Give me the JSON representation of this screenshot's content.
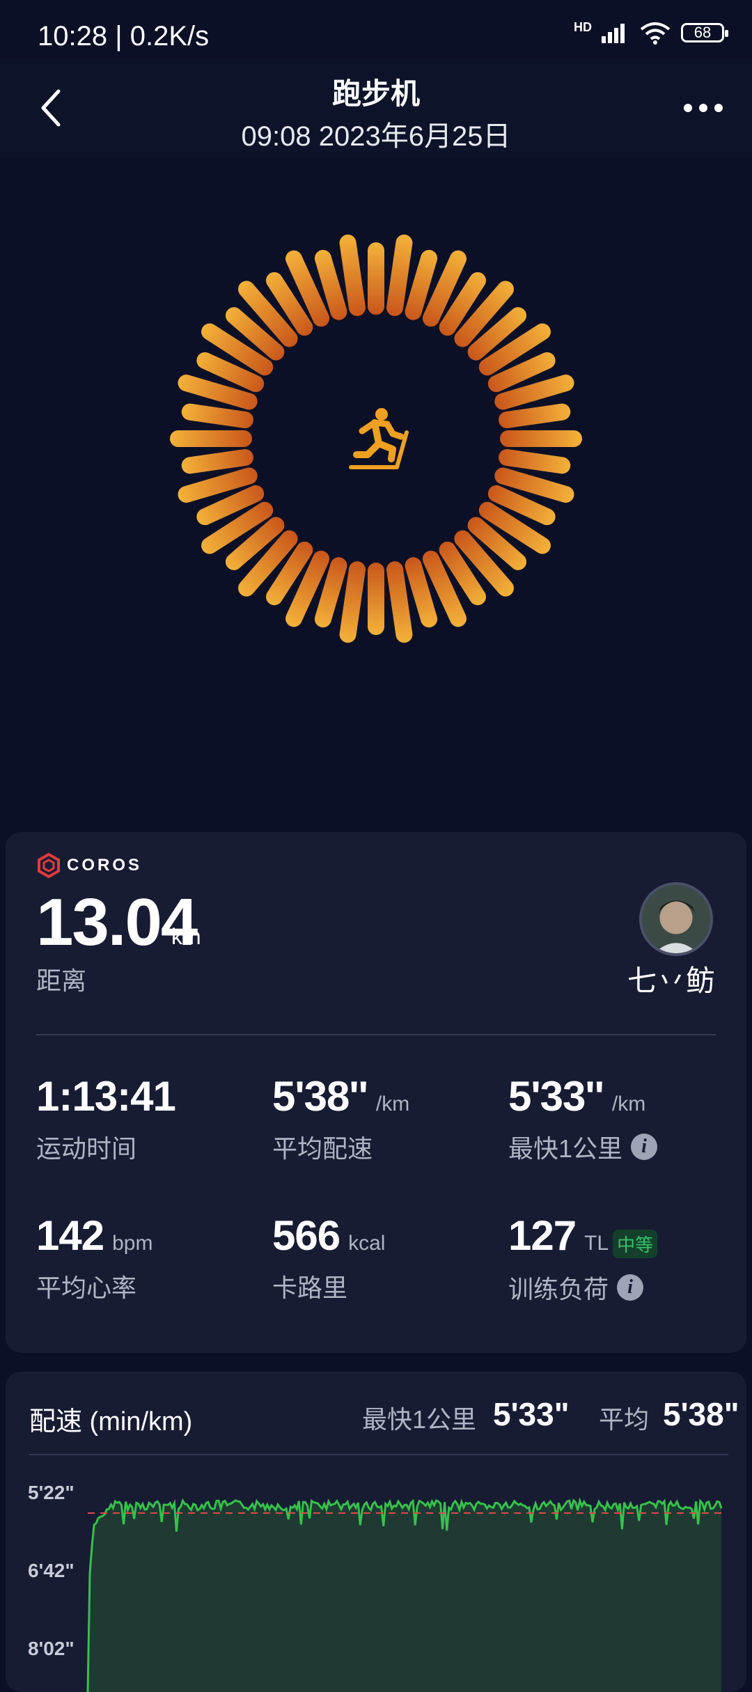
{
  "status_bar": {
    "time_speed": "10:28 | 0.2K/s",
    "network": "HD",
    "battery": "68"
  },
  "header": {
    "title": "跑步机",
    "datetime": "09:08 2023年6月25日"
  },
  "summary": {
    "brand": "COROS",
    "distance": {
      "value": "13.04",
      "unit": "km",
      "label": "距离"
    },
    "user": {
      "name": "七丷鲂"
    },
    "stats": [
      {
        "value": "1:13:41",
        "unit": "",
        "label": "运动时间"
      },
      {
        "value": "5'38''",
        "unit": "/km",
        "label": "平均配速"
      },
      {
        "value": "5'33''",
        "unit": "/km",
        "label": "最快1公里"
      },
      {
        "value": "142",
        "unit": "bpm",
        "label": "平均心率"
      },
      {
        "value": "566",
        "unit": "kcal",
        "label": "卡路里"
      },
      {
        "value": "127",
        "unit": "TL",
        "badge": "中等",
        "label": "训练负荷"
      }
    ]
  },
  "pace": {
    "title": "配速 (min/km)",
    "fastest_label": "最快1公里",
    "fastest_value": "5'33\"",
    "avg_label": "平均",
    "avg_value": "5'38\""
  },
  "chart_data": {
    "type": "area",
    "y_ticks": [
      "5'22\"",
      "6'42\"",
      "8'02\""
    ],
    "y_axis_inverted": true,
    "average_line": "5'38\"",
    "series": [],
    "colors": {
      "line": "#36c24a",
      "fill": "#1e3a33",
      "average": "#e04848"
    }
  },
  "colors": {
    "background": "#0b1026",
    "card": "#171c33",
    "accent_orange": "#f0a020",
    "badge_green": "#31c26a"
  }
}
